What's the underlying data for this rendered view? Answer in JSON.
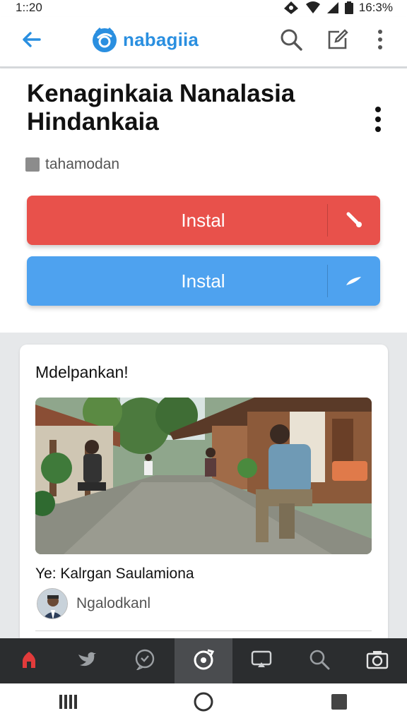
{
  "status_bar": {
    "time": "1::20",
    "battery": "16:3%",
    "icons": [
      "location-icon",
      "wifi-icon",
      "signal-icon",
      "battery-icon"
    ]
  },
  "app_bar": {
    "brand_name": "nabagiia",
    "icons": [
      "back-arrow-icon",
      "brand-logo-icon",
      "search-icon",
      "edit-icon",
      "more-vert-icon"
    ],
    "accent_color": "#2a8fe0"
  },
  "header": {
    "title": "Kenaginkaia Nanalasia Hindankaia",
    "subtitle": "tahamodan",
    "buttons": [
      {
        "label": "Instal",
        "color": "#e8514b",
        "icon": "wrench-icon"
      },
      {
        "label": "Instal",
        "color": "#4ea2ef",
        "icon": "pen-icon"
      }
    ]
  },
  "card": {
    "heading": "Mdelpankan!",
    "caption": "Ye: Kalrgan Saulamiona",
    "author": "Ngalodkanl"
  },
  "tab_bar": {
    "tabs": [
      {
        "icon": "home-icon",
        "active": false
      },
      {
        "icon": "bird-icon",
        "active": false
      },
      {
        "icon": "chat-heart-icon",
        "active": false
      },
      {
        "icon": "refresh-target-icon",
        "active": true
      },
      {
        "icon": "cast-icon",
        "active": false
      },
      {
        "icon": "search-icon",
        "active": false
      },
      {
        "icon": "camera-icon",
        "active": false
      }
    ],
    "home_color": "#e23b3b"
  },
  "system_nav": [
    "recents-icon",
    "home-circle-icon",
    "back-square-icon"
  ]
}
